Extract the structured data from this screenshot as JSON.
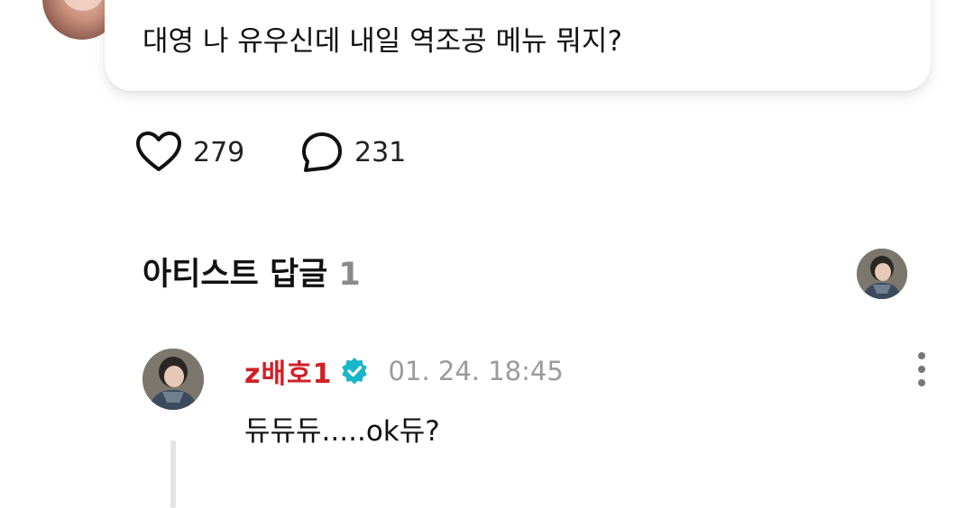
{
  "post": {
    "text": "대영 나 유우신데 내일 역조공 메뉴 뭐지?"
  },
  "reactions": {
    "likes": "279",
    "comments": "231"
  },
  "artist_replies": {
    "title": "아티스트 답글",
    "count": "1"
  },
  "reply": {
    "author": "z배호1",
    "timestamp": "01. 24. 18:45",
    "text": "듀듀듀.....ok듀?"
  },
  "colors": {
    "author_name": "#d21f26",
    "verified_badge": "#19b5c8",
    "muted_text": "#9a9a9a"
  },
  "icons": {
    "like": "heart-outline-icon",
    "comment": "speech-bubble-icon",
    "verified": "verified-badge-icon",
    "more": "more-vertical-icon"
  }
}
